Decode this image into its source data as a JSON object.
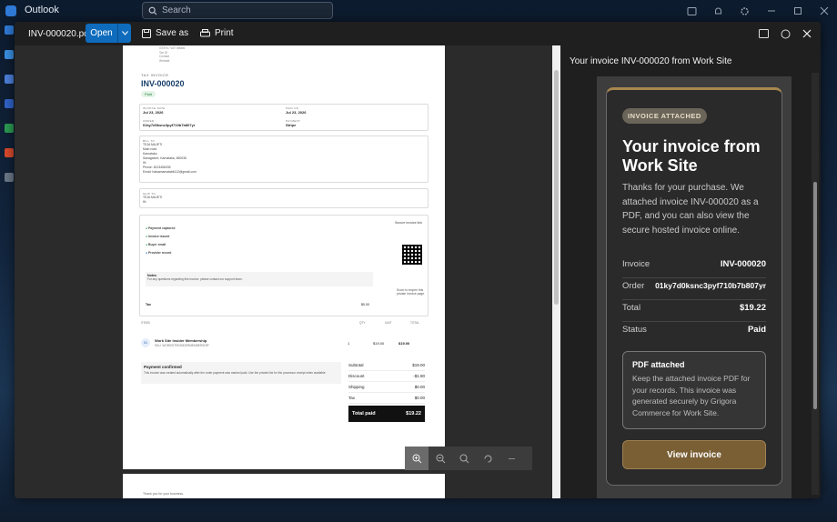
{
  "app": {
    "name": "Outlook",
    "search_placeholder": "Search"
  },
  "viewer": {
    "filename": "INV-000020.pdf",
    "open_label": "Open",
    "save_as_label": "Save as",
    "print_label": "Print"
  },
  "pdf": {
    "tax_invoice_label": "TAX INVOICE",
    "invoice_number": "INV-000020",
    "status_pill": "Paid",
    "invoice_date_label": "INVOICE DATE",
    "invoice_date": "Jul 23, 2026",
    "paid_on_label": "PAID ON",
    "paid_on": "Jul 23, 2026",
    "order_label": "ORDER",
    "order_id": "01ky7d0ksnc3pyf710b7b807yr",
    "payment_label": "PAYMENT",
    "payment_method": "Stripe",
    "bill_to_label": "BILL TO",
    "bill_to_lines": [
      "TEJA MAJETI",
      "Main road",
      "Karnataka",
      "Sanagalore, Karnataka, 560036",
      "IN",
      "Phone: 8123456035",
      "Email: hatsamamatabit112@gmail.com"
    ],
    "ship_to_label": "SHIP TO",
    "ship_to_lines": [
      "TEJA MAJETI",
      "IN"
    ],
    "secure_link_label": "Secure invoice link",
    "scan_text": "Scan to reopen this private invoice page.",
    "timeline": [
      "Payment captured",
      "Invoice issued",
      "Buyer email",
      "Provider record"
    ],
    "notes_label": "Notes",
    "notes_text": "For any questions regarding this invoice, please contact our support team.",
    "tax_label": "Tax",
    "tax_small": "$0.00",
    "items_label": "ITEMS",
    "col_qty": "QTY",
    "col_unit": "UNIT",
    "col_total": "TOTAL",
    "item_badge": "01",
    "item_name": "Work Site Insider Membership",
    "item_sku": "SKU: WORKSITEINSIDERMEMBERSHIP",
    "item_qty": "1",
    "item_unit": "$19.00",
    "item_total": "$19.00",
    "payment_confirmed": "Payment confirmed",
    "payment_text": "This invoice was created automatically after the order payment was marked paid. Use the private link for the processor receipt when available.",
    "subtotal_label": "Subtotal",
    "subtotal": "$19.00",
    "discount_label": "Discount",
    "discount": "-$1.90",
    "shipping_label": "Shipping",
    "shipping": "$0.00",
    "tax_total_label": "Tax",
    "tax_total": "$0.00",
    "total_paid_label": "Total paid",
    "total_paid": "$19.22",
    "page2_text": "Thank you for your business."
  },
  "mail": {
    "subject": "Your invoice INV-000020 from Work Site",
    "badge": "INVOICE ATTACHED",
    "title": "Your invoice from Work Site",
    "intro": "Thanks for your purchase. We attached invoice INV-000020 as a PDF, and you can also view the secure hosted invoice online.",
    "invoice_label": "Invoice",
    "invoice_value": "INV-000020",
    "order_label": "Order",
    "order_value": "01ky7d0ksnc3pyf710b7b807yr",
    "total_label": "Total",
    "total_value": "$19.22",
    "status_label": "Status",
    "status_value": "Paid",
    "pdf_box_title": "PDF attached",
    "pdf_box_text": "Keep the attached invoice PDF for your records. This invoice was generated securely by Grigora Commerce for Work Site.",
    "view_button": "View invoice"
  },
  "colors": {
    "accent": "#0f6cbd",
    "gold": "#a8874f",
    "button_brown": "#7a5f35"
  }
}
